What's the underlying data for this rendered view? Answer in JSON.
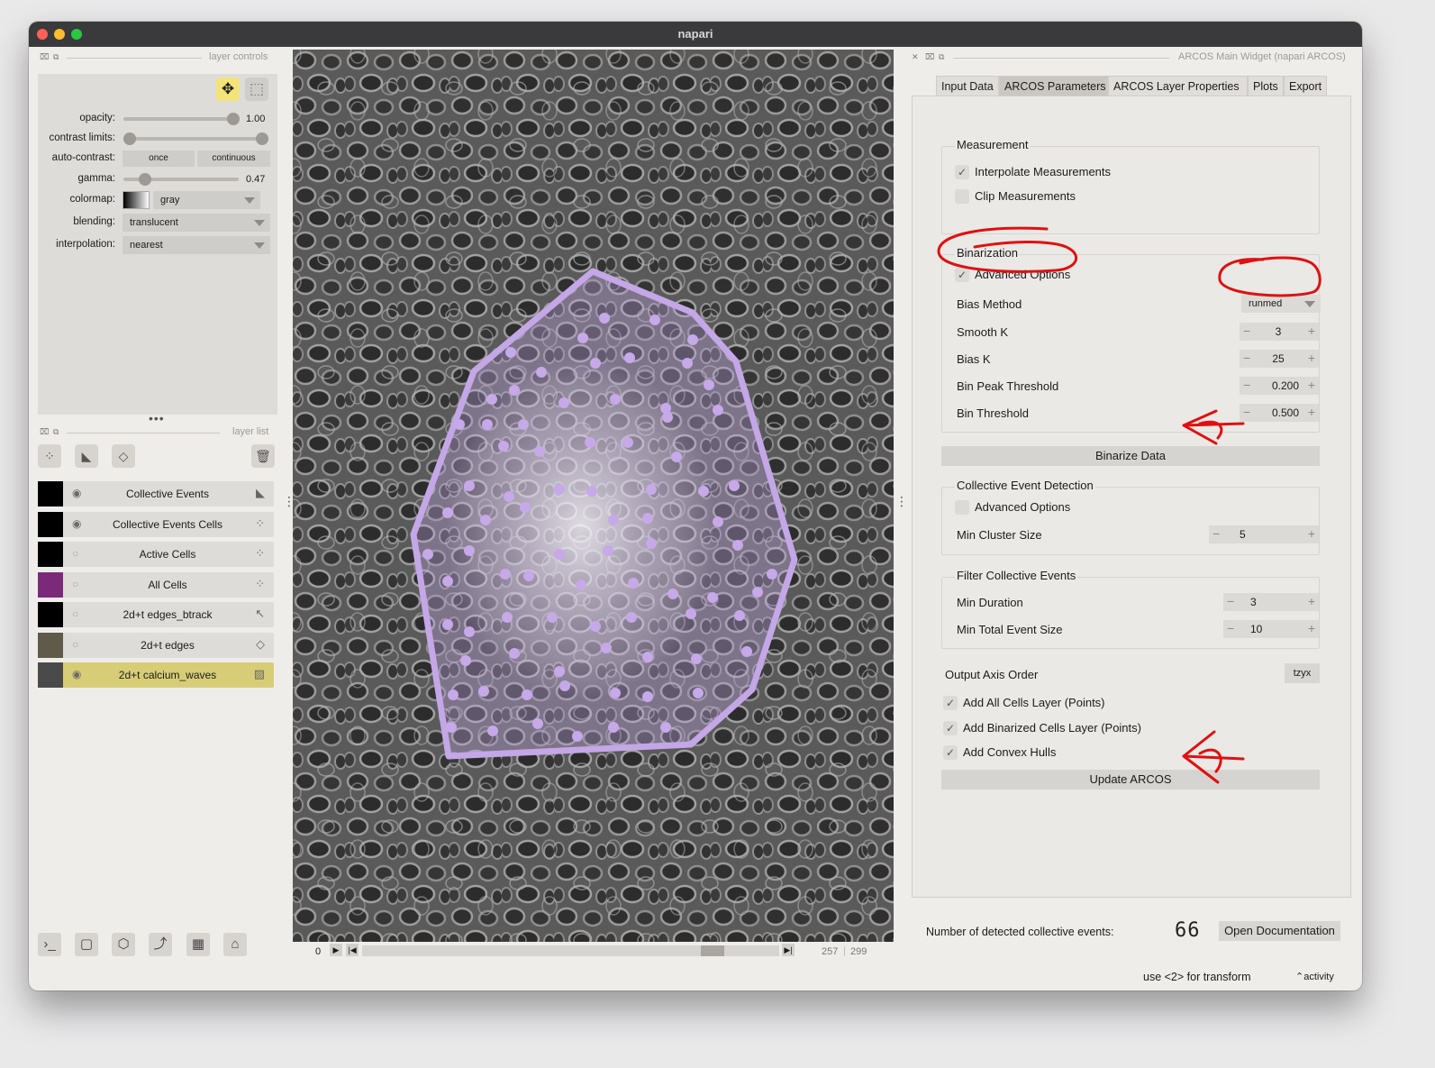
{
  "window": {
    "title": "napari"
  },
  "layer_controls": {
    "dock_title": "layer controls",
    "opacity_label": "opacity:",
    "opacity_value": "1.00",
    "contrast_label": "contrast limits:",
    "auto_contrast_label": "auto-contrast:",
    "once_label": "once",
    "continuous_label": "continuous",
    "gamma_label": "gamma:",
    "gamma_value": "0.47",
    "colormap_label": "colormap:",
    "colormap_value": "gray",
    "blending_label": "blending:",
    "blending_value": "translucent",
    "interpolation_label": "interpolation:",
    "interpolation_value": "nearest"
  },
  "layer_list": {
    "dock_title": "layer list",
    "layers": [
      {
        "name": "Collective Events",
        "visible": true,
        "type_icon": "shapes-icon"
      },
      {
        "name": "Collective Events Cells",
        "visible": true,
        "type_icon": "points-icon"
      },
      {
        "name": "Active Cells",
        "visible": false,
        "type_icon": "points-icon"
      },
      {
        "name": "All Cells",
        "visible": false,
        "type_icon": "points-icon"
      },
      {
        "name": "2d+t edges_btrack",
        "visible": false,
        "type_icon": "tracks-icon"
      },
      {
        "name": "2d+t edges",
        "visible": false,
        "type_icon": "labels-icon"
      },
      {
        "name": "2d+t calcium_waves",
        "visible": true,
        "type_icon": "image-icon",
        "selected": true
      }
    ]
  },
  "viewer": {
    "frame_start": "0",
    "current_frame": "257",
    "total_frames": "299",
    "frame_fraction": 0.86
  },
  "arcos": {
    "dock_title": "ARCOS Main Widget (napari ARCOS)",
    "tabs": [
      "Input Data",
      "ARCOS Parameters",
      "ARCOS Layer Properties",
      "Plots",
      "Export"
    ],
    "active_tab": "ARCOS Parameters",
    "measurement": {
      "title": "Measurement",
      "interpolate_label": "Interpolate Measurements",
      "interpolate_checked": true,
      "clip_label": "Clip Measurements",
      "clip_checked": false
    },
    "binarization": {
      "title": "Binarization",
      "advanced_label": "Advanced Options",
      "advanced_checked": true,
      "bias_method_label": "Bias Method",
      "bias_method_value": "runmed",
      "smooth_k_label": "Smooth K",
      "smooth_k_value": "3",
      "bias_k_label": "Bias K",
      "bias_k_value": "25",
      "bin_peak_label": "Bin Peak Threshold",
      "bin_peak_value": "0.200",
      "bin_threshold_label": "Bin Threshold",
      "bin_threshold_value": "0.500"
    },
    "binarize_button": "Binarize Data",
    "ced": {
      "title": "Collective Event Detection",
      "advanced_label": "Advanced Options",
      "advanced_checked": false,
      "min_cluster_label": "Min Cluster Size",
      "min_cluster_value": "5"
    },
    "filter": {
      "title": "Filter Collective Events",
      "min_duration_label": "Min Duration",
      "min_duration_value": "3",
      "min_total_label": "Min Total Event Size",
      "min_total_value": "10"
    },
    "output_axis_label": "Output Axis Order",
    "output_axis_value": "tzyx",
    "add_all_cells_label": "Add All Cells Layer (Points)",
    "add_binarized_label": "Add Binarized Cells Layer (Points)",
    "add_hulls_label": "Add Convex Hulls",
    "update_button": "Update ARCOS",
    "detected_label": "Number of detected collective events:",
    "detected_value": "66",
    "open_doc_button": "Open Documentation"
  },
  "status": {
    "hint": "use <2> for transform",
    "activity": "activity"
  },
  "colors": {
    "hull": "#c3a7e6",
    "annotation_red": "#e01010",
    "selected_layer": "#d7cd77"
  }
}
